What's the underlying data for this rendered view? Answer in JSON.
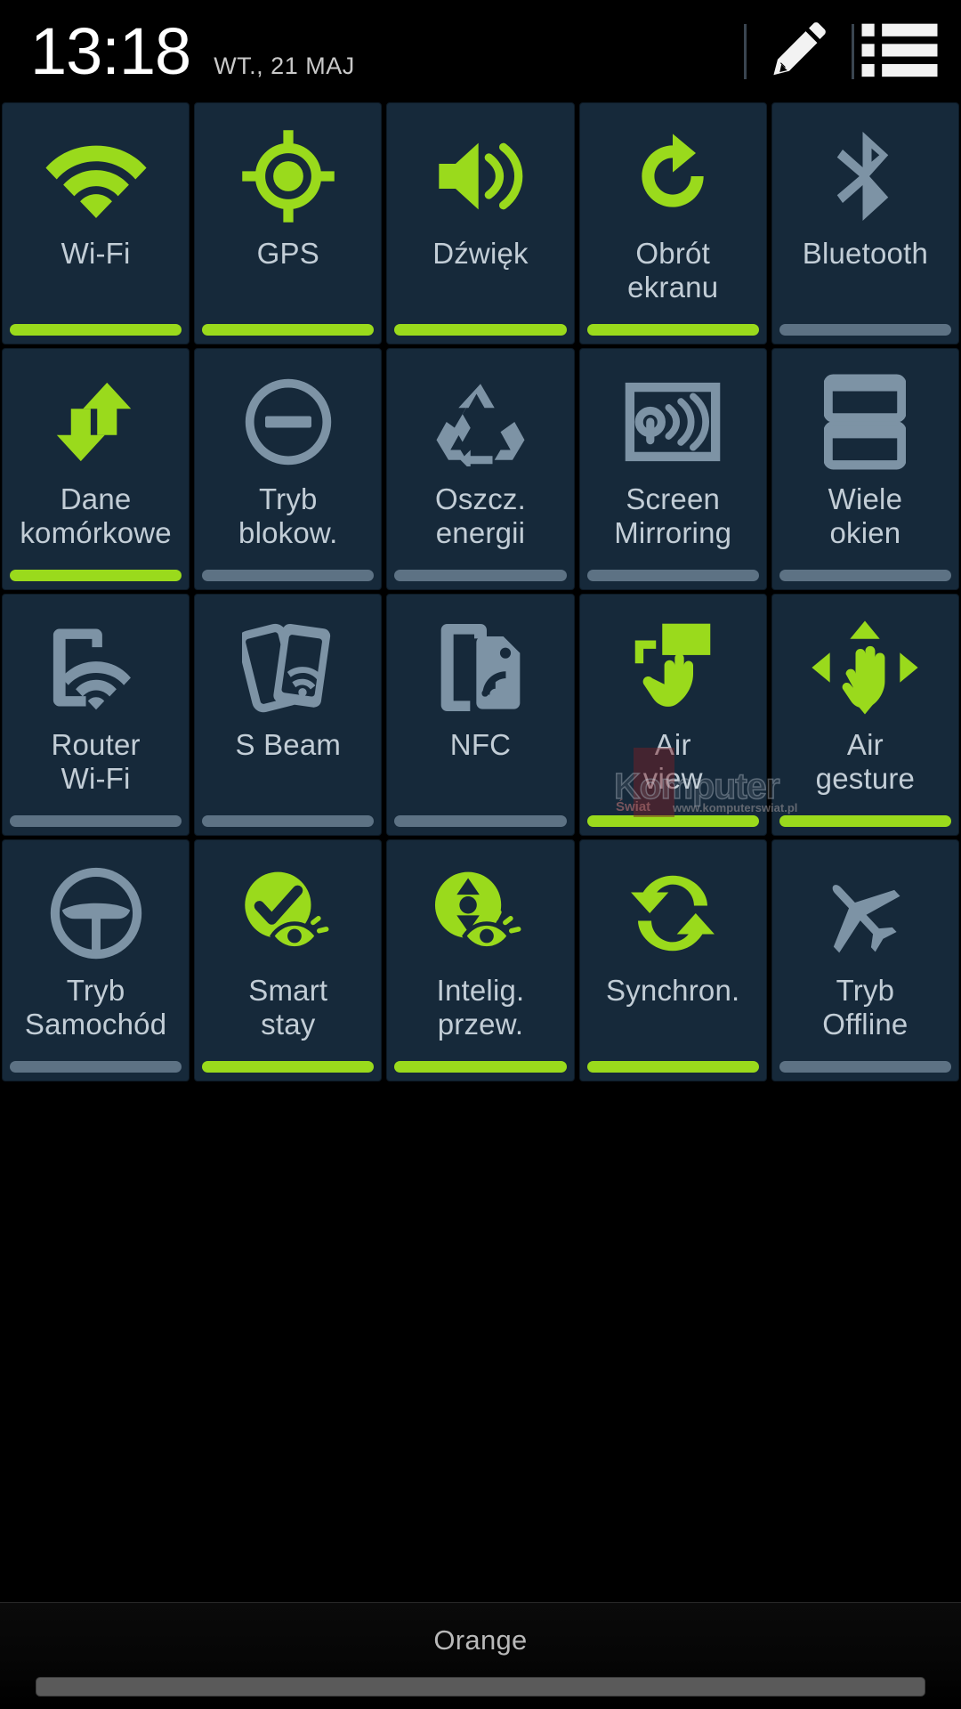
{
  "status_bar": {
    "clock": "13:18",
    "date": "WT., 21 MAJ",
    "edit_icon": "pencil-icon",
    "list_icon": "list-icon"
  },
  "colors": {
    "accent_on": "#9ada1c",
    "icon_off": "#7d93a5",
    "tile_bg": "#16293a",
    "label": "#c2cdd6",
    "bar_off": "#5d7284",
    "background": "#000000"
  },
  "tiles": [
    {
      "id": "wifi",
      "label_lines": [
        "Wi-Fi"
      ],
      "state": "on",
      "icon": "wifi-icon"
    },
    {
      "id": "gps",
      "label_lines": [
        "GPS"
      ],
      "state": "on",
      "icon": "gps-icon"
    },
    {
      "id": "sound",
      "label_lines": [
        "Dźwięk"
      ],
      "state": "on",
      "icon": "sound-icon"
    },
    {
      "id": "screen-rotation",
      "label_lines": [
        "Obrót",
        "ekranu"
      ],
      "state": "on",
      "icon": "rotate-icon"
    },
    {
      "id": "bluetooth",
      "label_lines": [
        "Bluetooth"
      ],
      "state": "off",
      "icon": "bluetooth-icon"
    },
    {
      "id": "mobile-data",
      "label_lines": [
        "Dane",
        "komórkowe"
      ],
      "state": "on",
      "icon": "data-arrows-icon"
    },
    {
      "id": "blocking-mode",
      "label_lines": [
        "Tryb",
        "blokow."
      ],
      "state": "off",
      "icon": "block-icon"
    },
    {
      "id": "power-saving",
      "label_lines": [
        "Oszcz.",
        "energii"
      ],
      "state": "off",
      "icon": "recycle-icon"
    },
    {
      "id": "screen-mirroring",
      "label_lines": [
        "Screen",
        "Mirroring"
      ],
      "state": "off",
      "icon": "screen-mirroring-icon"
    },
    {
      "id": "multi-window",
      "label_lines": [
        "Wiele",
        "okien"
      ],
      "state": "off",
      "icon": "multi-window-icon"
    },
    {
      "id": "wifi-hotspot",
      "label_lines": [
        "Router",
        "Wi-Fi"
      ],
      "state": "off",
      "icon": "hotspot-icon"
    },
    {
      "id": "s-beam",
      "label_lines": [
        "S Beam"
      ],
      "state": "off",
      "icon": "s-beam-icon"
    },
    {
      "id": "nfc",
      "label_lines": [
        "NFC"
      ],
      "state": "off",
      "icon": "nfc-icon"
    },
    {
      "id": "air-view",
      "label_lines": [
        "Air",
        "view"
      ],
      "state": "on",
      "icon": "air-view-icon"
    },
    {
      "id": "air-gesture",
      "label_lines": [
        "Air",
        "gesture"
      ],
      "state": "on",
      "icon": "air-gesture-icon"
    },
    {
      "id": "driving-mode",
      "label_lines": [
        "Tryb",
        "Samochód"
      ],
      "state": "off",
      "icon": "steering-wheel-icon"
    },
    {
      "id": "smart-stay",
      "label_lines": [
        "Smart",
        "stay"
      ],
      "state": "on",
      "icon": "smart-stay-icon"
    },
    {
      "id": "smart-scroll",
      "label_lines": [
        "Intelig.",
        "przew."
      ],
      "state": "on",
      "icon": "smart-scroll-icon"
    },
    {
      "id": "sync",
      "label_lines": [
        "Synchron."
      ],
      "state": "on",
      "icon": "sync-icon"
    },
    {
      "id": "airplane-mode",
      "label_lines": [
        "Tryb",
        "Offline"
      ],
      "state": "off",
      "icon": "airplane-icon"
    }
  ],
  "watermark": {
    "word": "Komputer",
    "sub": "Świat",
    "url": "www.komputerswiat.pl"
  },
  "footer": {
    "carrier": "Orange"
  }
}
